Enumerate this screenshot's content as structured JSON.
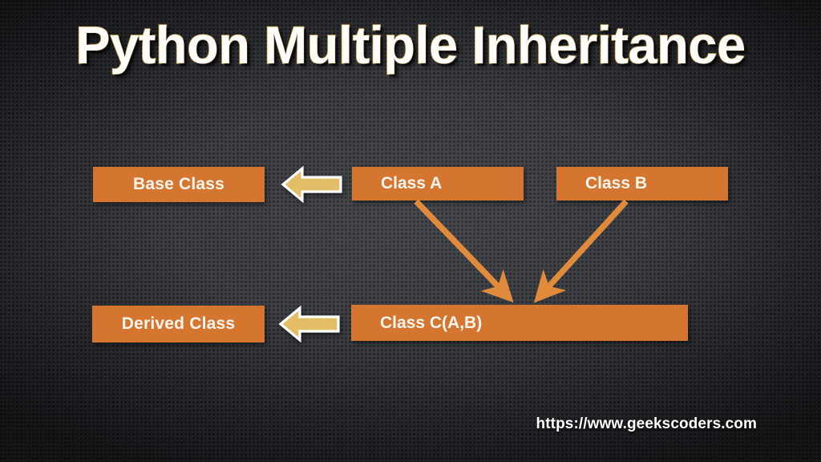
{
  "slide": {
    "title": "Python Multiple Inheritance",
    "footer_url": "https://www.geekscoders.com"
  },
  "diagram": {
    "boxes": [
      {
        "id": "base",
        "label": "Base Class",
        "role": "annotation"
      },
      {
        "id": "class_a",
        "label": "Class A",
        "role": "class"
      },
      {
        "id": "class_b",
        "label": "Class B",
        "role": "class"
      },
      {
        "id": "derived",
        "label": "Derived Class",
        "role": "annotation"
      },
      {
        "id": "class_c",
        "label": "Class C(A,B)",
        "role": "class"
      }
    ],
    "pale_arrows": [
      {
        "id": "base-pointer",
        "direction": "left",
        "points_to": "Base Class"
      },
      {
        "id": "derived-pointer",
        "direction": "left",
        "points_to": "Derived Class"
      }
    ],
    "connectors": [
      {
        "id": "a-to-c",
        "from": "Class A",
        "to": "Class C(A,B)"
      },
      {
        "id": "b-to-c",
        "from": "Class B",
        "to": "Class C(A,B)"
      }
    ]
  },
  "colors": {
    "box_fill": "#d4762f",
    "box_text": "#fdf6ee",
    "pale_arrow_fill": "#e2bf67",
    "pale_arrow_stroke": "#ffffff",
    "connector": "#e08a3c",
    "title_fill": "#fdfcf8",
    "title_outline": "#c79a3e",
    "background": "#34373c"
  }
}
